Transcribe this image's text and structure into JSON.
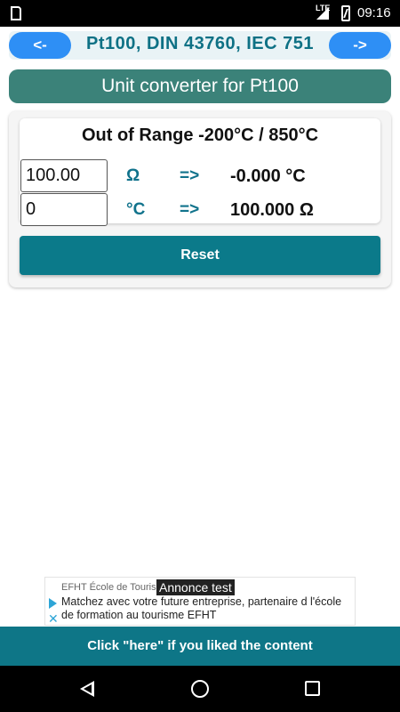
{
  "status_bar": {
    "network": "LTE",
    "time": "09:16",
    "icons": [
      "sd-card-icon",
      "signal-icon",
      "battery-charging-icon"
    ]
  },
  "nav": {
    "prev_label": "<-",
    "next_label": "->",
    "title": "Pt100,  DIN 43760, IEC 751"
  },
  "header": {
    "title": "Unit converter for Pt100"
  },
  "converter": {
    "range_text": "Out of Range -200°C / 850°C",
    "rows": [
      {
        "input_value": "100.00",
        "unit": "Ω",
        "arrow": "=>",
        "result": "-0.000 °C"
      },
      {
        "input_value": "0",
        "unit": "°C",
        "arrow": "=>",
        "result": "100.000 Ω"
      }
    ],
    "reset_label": "Reset"
  },
  "ad": {
    "advertiser": "EFHT École de Touris",
    "tag": "Annonce test",
    "text": "Matchez avec votre future entreprise, partenaire d l'école de formation au tourisme EFHT"
  },
  "footer": {
    "like_label": "Click \"here\" if you liked the content"
  },
  "colors": {
    "teal_dark": "#0b7a8a",
    "header_green": "#3b8279",
    "nav_blue": "#2e8ff5",
    "title_teal": "#0e7185"
  }
}
